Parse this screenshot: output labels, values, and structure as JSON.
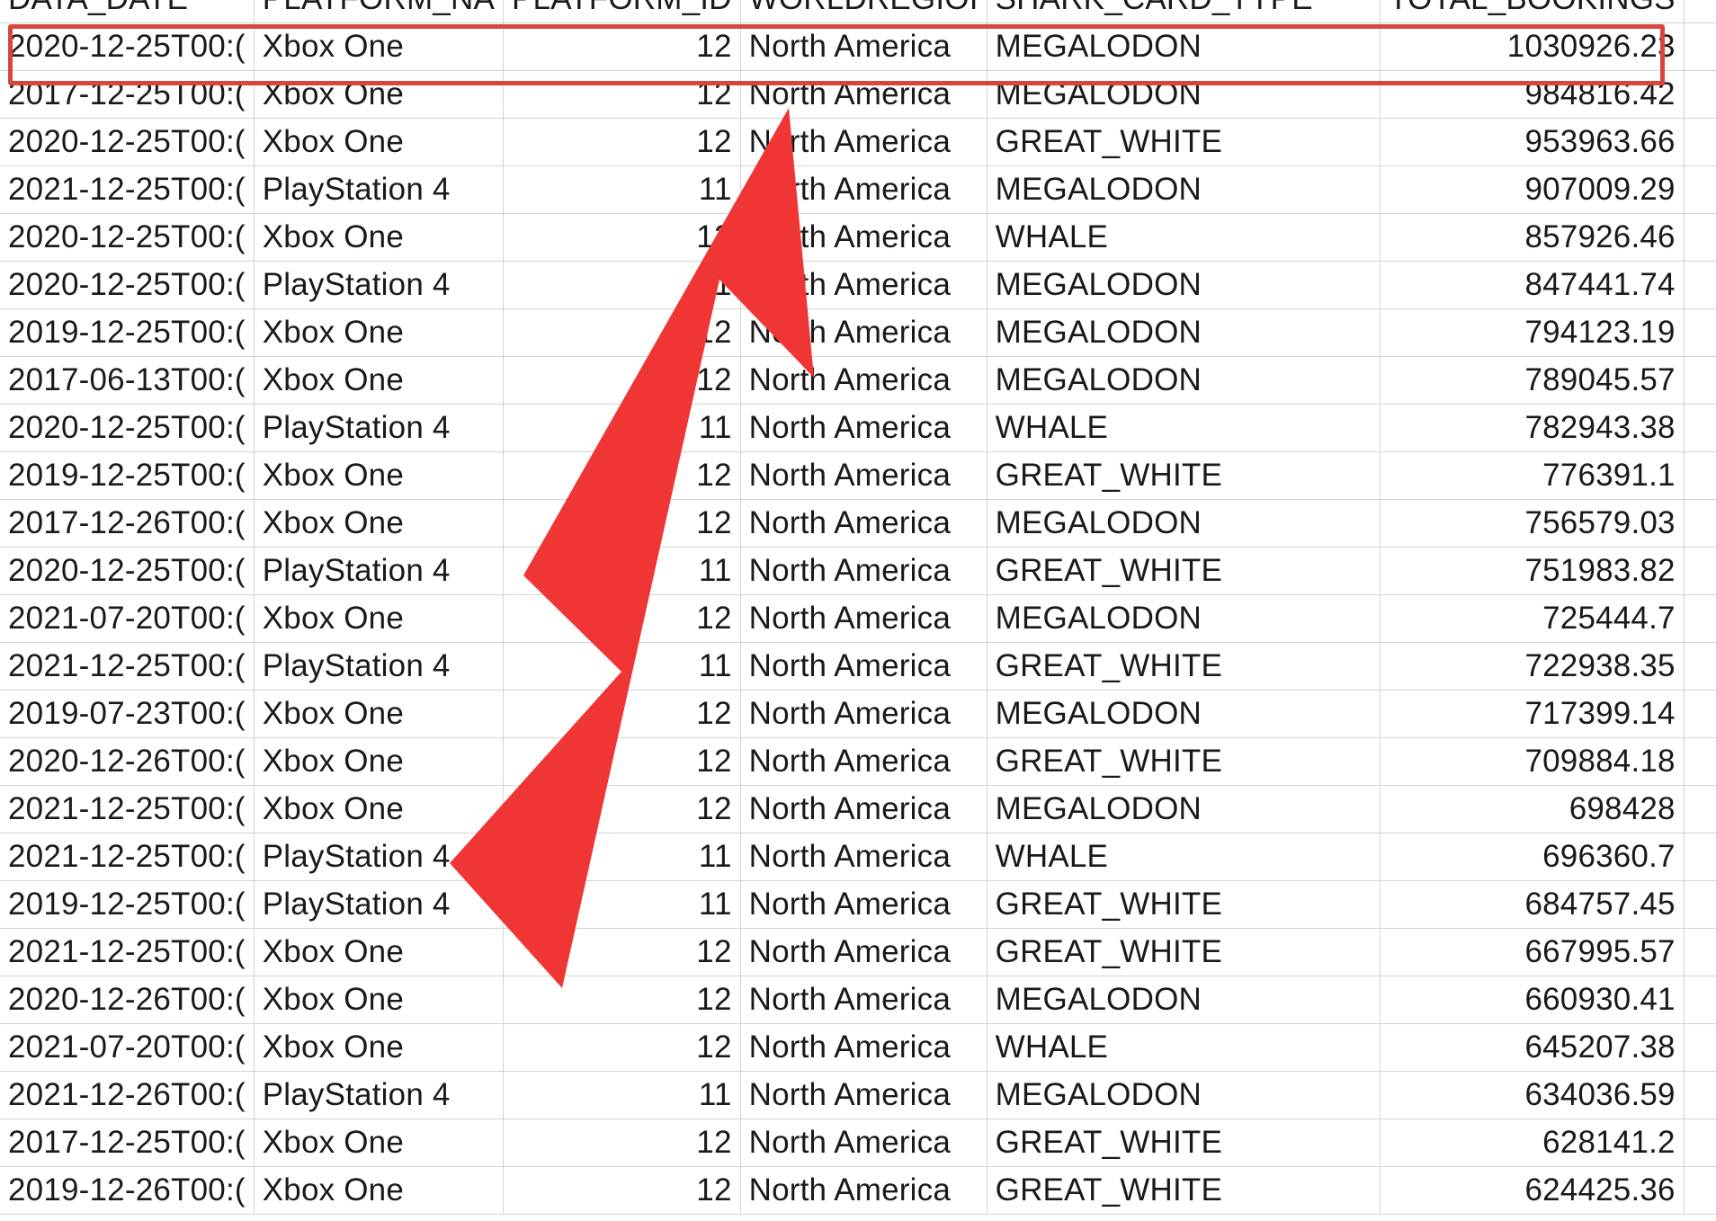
{
  "columns": [
    {
      "label": "DATA_DATE",
      "align": "left"
    },
    {
      "label": "PLATFORM_NA",
      "align": "left"
    },
    {
      "label": "PLATFORM_ID",
      "align": "left"
    },
    {
      "label": "WORLDREGIOI",
      "align": "left"
    },
    {
      "label": "SHARK_CARD_TYPE",
      "align": "left"
    },
    {
      "label": "TOTAL_BOOKINGS",
      "align": "right"
    }
  ],
  "rows": [
    [
      "2020-12-25T00:(",
      "Xbox One",
      "12",
      "North America",
      "MEGALODON",
      "1030926.23"
    ],
    [
      "2017-12-25T00:(",
      "Xbox One",
      "12",
      "North America",
      "MEGALODON",
      "984816.42"
    ],
    [
      "2020-12-25T00:(",
      "Xbox One",
      "12",
      "North America",
      "GREAT_WHITE",
      "953963.66"
    ],
    [
      "2021-12-25T00:(",
      "PlayStation 4",
      "11",
      "North America",
      "MEGALODON",
      "907009.29"
    ],
    [
      "2020-12-25T00:(",
      "Xbox One",
      "12",
      "North America",
      "WHALE",
      "857926.46"
    ],
    [
      "2020-12-25T00:(",
      "PlayStation 4",
      "11",
      "North America",
      "MEGALODON",
      "847441.74"
    ],
    [
      "2019-12-25T00:(",
      "Xbox One",
      "12",
      "North America",
      "MEGALODON",
      "794123.19"
    ],
    [
      "2017-06-13T00:(",
      "Xbox One",
      "12",
      "North America",
      "MEGALODON",
      "789045.57"
    ],
    [
      "2020-12-25T00:(",
      "PlayStation 4",
      "11",
      "North America",
      "WHALE",
      "782943.38"
    ],
    [
      "2019-12-25T00:(",
      "Xbox One",
      "12",
      "North America",
      "GREAT_WHITE",
      "776391.1"
    ],
    [
      "2017-12-26T00:(",
      "Xbox One",
      "12",
      "North America",
      "MEGALODON",
      "756579.03"
    ],
    [
      "2020-12-25T00:(",
      "PlayStation 4",
      "11",
      "North America",
      "GREAT_WHITE",
      "751983.82"
    ],
    [
      "2021-07-20T00:(",
      "Xbox One",
      "12",
      "North America",
      "MEGALODON",
      "725444.7"
    ],
    [
      "2021-12-25T00:(",
      "PlayStation 4",
      "11",
      "North America",
      "GREAT_WHITE",
      "722938.35"
    ],
    [
      "2019-07-23T00:(",
      "Xbox One",
      "12",
      "North America",
      "MEGALODON",
      "717399.14"
    ],
    [
      "2020-12-26T00:(",
      "Xbox One",
      "12",
      "North America",
      "GREAT_WHITE",
      "709884.18"
    ],
    [
      "2021-12-25T00:(",
      "Xbox One",
      "12",
      "North America",
      "MEGALODON",
      "698428"
    ],
    [
      "2021-12-25T00:(",
      "PlayStation 4",
      "11",
      "North America",
      "WHALE",
      "696360.7"
    ],
    [
      "2019-12-25T00:(",
      "PlayStation 4",
      "11",
      "North America",
      "GREAT_WHITE",
      "684757.45"
    ],
    [
      "2021-12-25T00:(",
      "Xbox One",
      "12",
      "North America",
      "GREAT_WHITE",
      "667995.57"
    ],
    [
      "2020-12-26T00:(",
      "Xbox One",
      "12",
      "North America",
      "MEGALODON",
      "660930.41"
    ],
    [
      "2021-07-20T00:(",
      "Xbox One",
      "12",
      "North America",
      "WHALE",
      "645207.38"
    ],
    [
      "2021-12-26T00:(",
      "PlayStation 4",
      "11",
      "North America",
      "MEGALODON",
      "634036.59"
    ],
    [
      "2017-12-25T00:(",
      "Xbox One",
      "12",
      "North America",
      "GREAT_WHITE",
      "628141.2"
    ],
    [
      "2019-12-26T00:(",
      "Xbox One",
      "12",
      "North America",
      "GREAT_WHITE",
      "624425.36"
    ]
  ],
  "highlighted_row": 0,
  "overlay": {
    "highlight_color": "#d9453a",
    "arrow_color": "#f03535",
    "arrow_icon": "arrow-up-right-icon"
  },
  "colors": {
    "grid_line": "#d4d4d4",
    "text": "#1a1a1a",
    "background": "#ffffff"
  }
}
